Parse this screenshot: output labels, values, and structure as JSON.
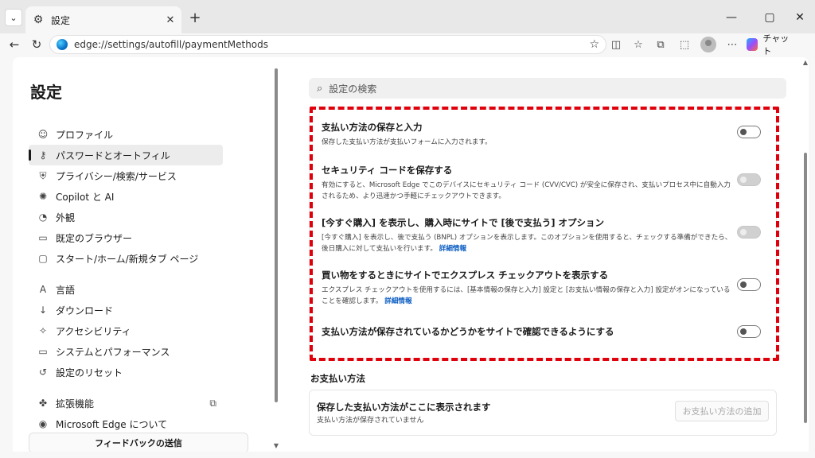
{
  "tab": {
    "title": "設定"
  },
  "address": {
    "url": "edge://settings/autofill/paymentMethods"
  },
  "toolbar": {
    "chat_label": "チャット"
  },
  "sidebar": {
    "title": "設定",
    "items": [
      {
        "label": "プロファイル",
        "icon": "profile-icon",
        "glyph": "☺"
      },
      {
        "label": "パスワードとオートフィル",
        "icon": "key-icon",
        "glyph": "⚷",
        "active": true
      },
      {
        "label": "プライバシー/検索/サービス",
        "icon": "lock-icon",
        "glyph": "⛨"
      },
      {
        "label": "Copilot と AI",
        "icon": "copilot-icon",
        "glyph": "✺"
      },
      {
        "label": "外観",
        "icon": "appearance-icon",
        "glyph": "◔"
      },
      {
        "label": "既定のブラウザー",
        "icon": "browser-icon",
        "glyph": "▭"
      },
      {
        "label": "スタート/ホーム/新規タブ ページ",
        "icon": "start-page-icon",
        "glyph": "▢"
      },
      {
        "label": "言語",
        "icon": "language-icon",
        "glyph": "A"
      },
      {
        "label": "ダウンロード",
        "icon": "download-icon",
        "glyph": "↓"
      },
      {
        "label": "アクセシビリティ",
        "icon": "accessibility-icon",
        "glyph": "✧"
      },
      {
        "label": "システムとパフォーマンス",
        "icon": "system-icon",
        "glyph": "▭"
      },
      {
        "label": "設定のリセット",
        "icon": "reset-icon",
        "glyph": "↺"
      },
      {
        "label": "拡張機能",
        "icon": "extensions-icon",
        "glyph": "✤"
      },
      {
        "label": "Microsoft Edge について",
        "icon": "edge-icon",
        "glyph": "◉"
      }
    ],
    "feedback_label": "フィードバックの送信"
  },
  "search": {
    "placeholder": "設定の検索"
  },
  "settings": {
    "rows": [
      {
        "title": "支払い方法の保存と入力",
        "desc": "保存した支払い方法が支払いフォームに入力されます。",
        "enabled": true
      },
      {
        "title": "セキュリティ コードを保存する",
        "desc": "有効にすると、Microsoft Edge でこのデバイスにセキュリティ コード (CVV/CVC) が安全に保存され、支払いプロセス中に自動入力されるため、より迅速かつ手軽にチェックアウトできます。",
        "enabled": false
      },
      {
        "title": "[今すぐ購入] を表示し、購入時にサイトで [後で支払う] オプション",
        "desc": "[今すぐ購入] を表示し、後で支払う (BNPL) オプションを表示します。このオプションを使用すると、チェックする準備ができたら、後日購入に対して支払いを行います。",
        "link": "詳細情報",
        "enabled": false
      },
      {
        "title": "買い物をするときにサイトでエクスプレス チェックアウトを表示する",
        "desc": "エクスプレス チェックアウトを使用するには、[基本情報の保存と入力] 設定と [お支払い情報の保存と入力] 設定がオンになっていることを確認します。",
        "link": "詳細情報",
        "enabled": true
      },
      {
        "title": "支払い方法が保存されているかどうかをサイトで確認できるようにする",
        "desc": "",
        "enabled": true
      }
    ]
  },
  "payment_methods": {
    "section_title": "お支払い方法",
    "empty_title": "保存した支払い方法がここに表示されます",
    "empty_sub": "支払い方法が保存されていません",
    "add_label": "お支払い方法の追加"
  },
  "colors": {
    "highlight": "#e0000b",
    "link": "#0a5cc2"
  }
}
